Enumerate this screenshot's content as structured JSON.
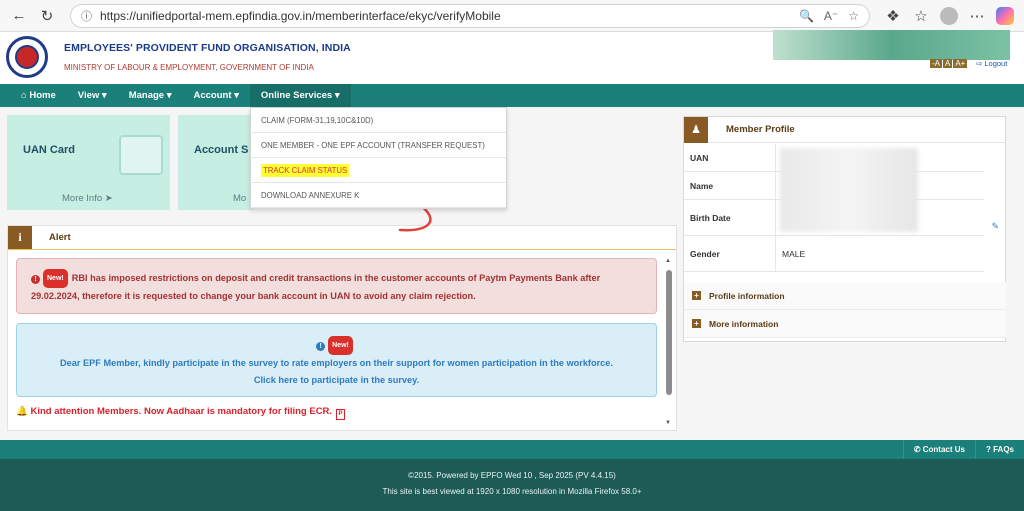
{
  "browser": {
    "url": "https://unifiedportal-mem.epfindia.gov.in/memberinterface/ekyc/verifyMobile",
    "icons": [
      "back-icon",
      "refresh-icon",
      "lock-icon",
      "zoom-icon",
      "read-aloud-icon",
      "favorite-icon",
      "extensions-icon",
      "collections-icon",
      "profile-avatar",
      "more-icon",
      "copilot-icon"
    ]
  },
  "header": {
    "org_name": "EMPLOYEES' PROVIDENT FUND ORGANISATION, INDIA",
    "ministry": "MINISTRY OF LABOUR & EMPLOYMENT, GOVERNMENT OF INDIA",
    "font_sizes": [
      "-A",
      "A",
      "A+"
    ],
    "logout": "Logout"
  },
  "nav": {
    "home": "Home",
    "view": "View",
    "manage": "Manage",
    "account": "Account",
    "online_services": "Online Services"
  },
  "dropdown": {
    "options": [
      "CLAIM (FORM-31,19,10C&10D)",
      "ONE MEMBER - ONE EPF ACCOUNT (TRANSFER REQUEST)",
      "TRACK CLAIM STATUS",
      "DOWNLOAD ANNEXURE K"
    ]
  },
  "cards": {
    "uan": {
      "title": "UAN Card",
      "more": "More Info"
    },
    "account": {
      "title": "Account S",
      "more": "Mo"
    }
  },
  "alert": {
    "title": "Alert",
    "badge": "New!",
    "red_text": "RBI has imposed restrictions on deposit and credit transactions in the customer accounts of Paytm Payments Bank after 29.02.2024, therefore it is requested to change your bank account in UAN to avoid any claim rejection.",
    "blue_text": "Dear EPF Member, kindly participate in the survey to rate employers on their support for women participation in the workforce. Click here to participate in the survey.",
    "kind_text": "Kind attention Members. Now Aadhaar is mandatory for filing ECR."
  },
  "profile": {
    "title": "Member Profile",
    "rows": [
      {
        "label": "UAN",
        "value": ""
      },
      {
        "label": "Name",
        "value": ""
      },
      {
        "label": "Birth Date",
        "value": ""
      },
      {
        "label": "Gender",
        "value": "MALE"
      }
    ],
    "profile_info": "Profile information",
    "more_info": "More information"
  },
  "footer": {
    "contact": "Contact Us",
    "faqs": "FAQs",
    "line1": "©2015. Powered by EPFO Wed 10 , Sep 2025 (PV 4.4.15)",
    "line2": "This site is best viewed at 1920 x 1080 resolution in Mozilla Firefox 58.0+"
  },
  "colors": {
    "nav": "#1b7f7a",
    "highlight": "#ffff33",
    "alert_red": "#a33232",
    "alert_blue": "#2f7bbf",
    "arrow": "#e0413a"
  }
}
